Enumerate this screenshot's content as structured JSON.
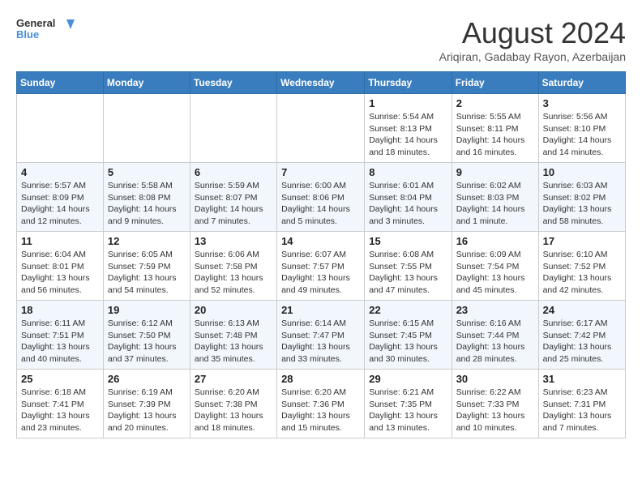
{
  "header": {
    "logo_line1": "General",
    "logo_line2": "Blue",
    "month_year": "August 2024",
    "location": "Ariqiran, Gadabay Rayon, Azerbaijan"
  },
  "weekdays": [
    "Sunday",
    "Monday",
    "Tuesday",
    "Wednesday",
    "Thursday",
    "Friday",
    "Saturday"
  ],
  "weeks": [
    [
      {
        "day": "",
        "info": ""
      },
      {
        "day": "",
        "info": ""
      },
      {
        "day": "",
        "info": ""
      },
      {
        "day": "",
        "info": ""
      },
      {
        "day": "1",
        "info": "Sunrise: 5:54 AM\nSunset: 8:13 PM\nDaylight: 14 hours\nand 18 minutes."
      },
      {
        "day": "2",
        "info": "Sunrise: 5:55 AM\nSunset: 8:11 PM\nDaylight: 14 hours\nand 16 minutes."
      },
      {
        "day": "3",
        "info": "Sunrise: 5:56 AM\nSunset: 8:10 PM\nDaylight: 14 hours\nand 14 minutes."
      }
    ],
    [
      {
        "day": "4",
        "info": "Sunrise: 5:57 AM\nSunset: 8:09 PM\nDaylight: 14 hours\nand 12 minutes."
      },
      {
        "day": "5",
        "info": "Sunrise: 5:58 AM\nSunset: 8:08 PM\nDaylight: 14 hours\nand 9 minutes."
      },
      {
        "day": "6",
        "info": "Sunrise: 5:59 AM\nSunset: 8:07 PM\nDaylight: 14 hours\nand 7 minutes."
      },
      {
        "day": "7",
        "info": "Sunrise: 6:00 AM\nSunset: 8:06 PM\nDaylight: 14 hours\nand 5 minutes."
      },
      {
        "day": "8",
        "info": "Sunrise: 6:01 AM\nSunset: 8:04 PM\nDaylight: 14 hours\nand 3 minutes."
      },
      {
        "day": "9",
        "info": "Sunrise: 6:02 AM\nSunset: 8:03 PM\nDaylight: 14 hours\nand 1 minute."
      },
      {
        "day": "10",
        "info": "Sunrise: 6:03 AM\nSunset: 8:02 PM\nDaylight: 13 hours\nand 58 minutes."
      }
    ],
    [
      {
        "day": "11",
        "info": "Sunrise: 6:04 AM\nSunset: 8:01 PM\nDaylight: 13 hours\nand 56 minutes."
      },
      {
        "day": "12",
        "info": "Sunrise: 6:05 AM\nSunset: 7:59 PM\nDaylight: 13 hours\nand 54 minutes."
      },
      {
        "day": "13",
        "info": "Sunrise: 6:06 AM\nSunset: 7:58 PM\nDaylight: 13 hours\nand 52 minutes."
      },
      {
        "day": "14",
        "info": "Sunrise: 6:07 AM\nSunset: 7:57 PM\nDaylight: 13 hours\nand 49 minutes."
      },
      {
        "day": "15",
        "info": "Sunrise: 6:08 AM\nSunset: 7:55 PM\nDaylight: 13 hours\nand 47 minutes."
      },
      {
        "day": "16",
        "info": "Sunrise: 6:09 AM\nSunset: 7:54 PM\nDaylight: 13 hours\nand 45 minutes."
      },
      {
        "day": "17",
        "info": "Sunrise: 6:10 AM\nSunset: 7:52 PM\nDaylight: 13 hours\nand 42 minutes."
      }
    ],
    [
      {
        "day": "18",
        "info": "Sunrise: 6:11 AM\nSunset: 7:51 PM\nDaylight: 13 hours\nand 40 minutes."
      },
      {
        "day": "19",
        "info": "Sunrise: 6:12 AM\nSunset: 7:50 PM\nDaylight: 13 hours\nand 37 minutes."
      },
      {
        "day": "20",
        "info": "Sunrise: 6:13 AM\nSunset: 7:48 PM\nDaylight: 13 hours\nand 35 minutes."
      },
      {
        "day": "21",
        "info": "Sunrise: 6:14 AM\nSunset: 7:47 PM\nDaylight: 13 hours\nand 33 minutes."
      },
      {
        "day": "22",
        "info": "Sunrise: 6:15 AM\nSunset: 7:45 PM\nDaylight: 13 hours\nand 30 minutes."
      },
      {
        "day": "23",
        "info": "Sunrise: 6:16 AM\nSunset: 7:44 PM\nDaylight: 13 hours\nand 28 minutes."
      },
      {
        "day": "24",
        "info": "Sunrise: 6:17 AM\nSunset: 7:42 PM\nDaylight: 13 hours\nand 25 minutes."
      }
    ],
    [
      {
        "day": "25",
        "info": "Sunrise: 6:18 AM\nSunset: 7:41 PM\nDaylight: 13 hours\nand 23 minutes."
      },
      {
        "day": "26",
        "info": "Sunrise: 6:19 AM\nSunset: 7:39 PM\nDaylight: 13 hours\nand 20 minutes."
      },
      {
        "day": "27",
        "info": "Sunrise: 6:20 AM\nSunset: 7:38 PM\nDaylight: 13 hours\nand 18 minutes."
      },
      {
        "day": "28",
        "info": "Sunrise: 6:20 AM\nSunset: 7:36 PM\nDaylight: 13 hours\nand 15 minutes."
      },
      {
        "day": "29",
        "info": "Sunrise: 6:21 AM\nSunset: 7:35 PM\nDaylight: 13 hours\nand 13 minutes."
      },
      {
        "day": "30",
        "info": "Sunrise: 6:22 AM\nSunset: 7:33 PM\nDaylight: 13 hours\nand 10 minutes."
      },
      {
        "day": "31",
        "info": "Sunrise: 6:23 AM\nSunset: 7:31 PM\nDaylight: 13 hours\nand 7 minutes."
      }
    ]
  ]
}
